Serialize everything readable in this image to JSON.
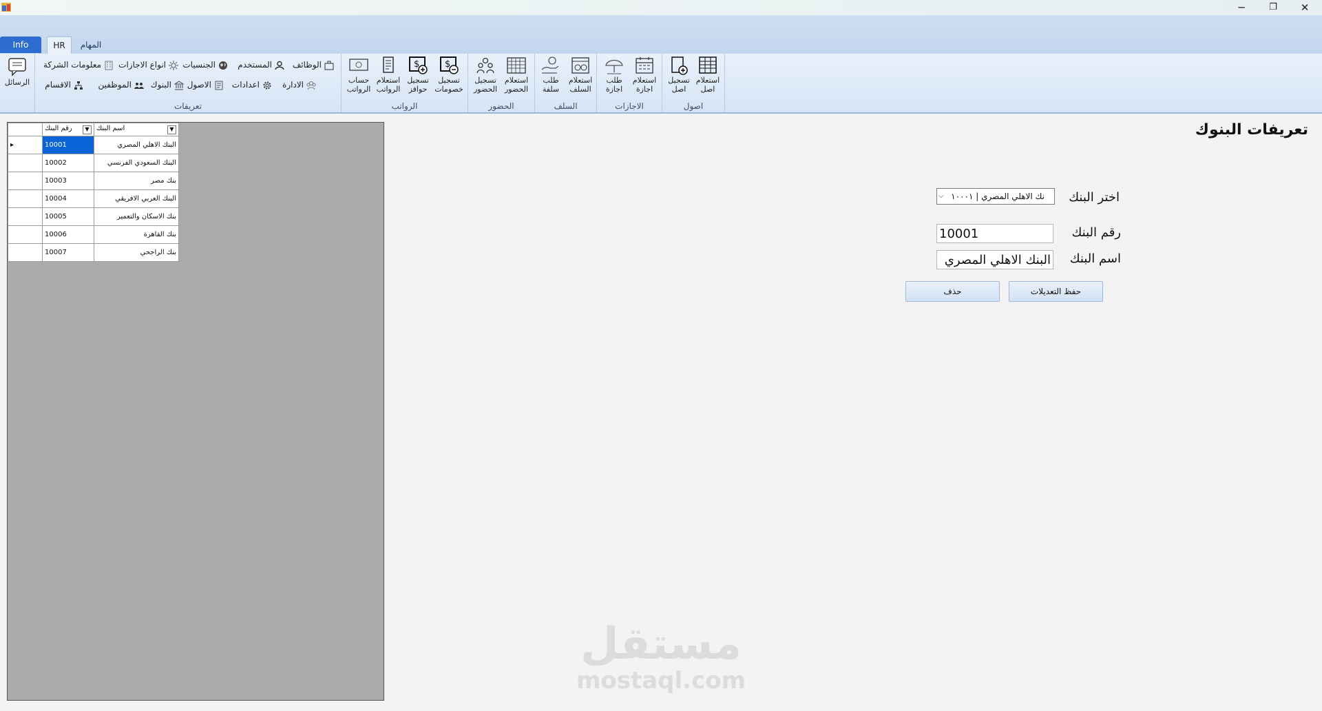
{
  "window": {
    "minimize_glyph": "─",
    "restore_glyph": "❐",
    "close_glyph": "✕"
  },
  "tabs": {
    "file": "Info",
    "active": "HR",
    "other": "المهام"
  },
  "ribbon": {
    "messages_label": "الرسائل",
    "groups": {
      "definitions": "تعريفات",
      "salaries": "الرواتب",
      "attendance": "الحضور",
      "advances": "السلف",
      "vacations": "الاجازات",
      "assets": "اصول"
    },
    "small_buttons": {
      "jobs": "الوظائف",
      "user": "المستخدم",
      "nationalities": "الجنسيات",
      "vacation_types": "انواع الاجازات",
      "company_info": "معلومات الشركة",
      "administration": "الادارة",
      "settings": "اعدادات",
      "assets": "الاصول",
      "banks": "البنوك",
      "employees": "الموظفين",
      "departments": "الاقسام"
    },
    "big_buttons": {
      "salary_calc": [
        "حساب",
        "الرواتب"
      ],
      "salary_query": [
        "استعلام",
        "الرواتب"
      ],
      "incentives": [
        "تسجيل",
        "حوافز"
      ],
      "deductions": [
        "تسجيل",
        "خصومات"
      ],
      "attendance_reg": [
        "تسجيل",
        "الحضور"
      ],
      "attendance_query": [
        "استعلام",
        "الحضور"
      ],
      "advance_request": [
        "طلب",
        "سلفة"
      ],
      "advance_query": [
        "استعلام",
        "السلف"
      ],
      "vacation_request": [
        "طلب",
        "اجازة"
      ],
      "vacation_query": [
        "استعلام",
        "اجازة"
      ],
      "asset_reg": [
        "تسجيل",
        "اصل"
      ],
      "asset_query": [
        "استعلام",
        "اصل"
      ]
    }
  },
  "grid": {
    "headers": {
      "bank_no": "رقم البنك",
      "bank_name": "اسم البنك"
    },
    "row_marker": "▸",
    "rows": [
      {
        "no": "10001",
        "name": "البنك الاهلي المصري"
      },
      {
        "no": "10002",
        "name": "البنك السعودي الفرنسي"
      },
      {
        "no": "10003",
        "name": "بنك مصر"
      },
      {
        "no": "10004",
        "name": "البنك العربي الافريقي"
      },
      {
        "no": "10005",
        "name": "بنك الاسكان والتعمير"
      },
      {
        "no": "10006",
        "name": "بنك القاهرة"
      },
      {
        "no": "10007",
        "name": "بنك الراجحي"
      }
    ]
  },
  "form": {
    "title": "تعريفات البنوك",
    "select_label": "اختر البنك",
    "select_value": "نك الاهلي المصري | ١٠٠٠١",
    "bank_no_label": "رقم البنك",
    "bank_no_value": "10001",
    "bank_name_label": "اسم البنك",
    "bank_name_value": "البنك الاهلي المصري",
    "save_button": "حفظ التعديلات",
    "delete_button": "حذف"
  },
  "watermark": {
    "arabic": "مستقل",
    "latin": "mostaql.com"
  }
}
